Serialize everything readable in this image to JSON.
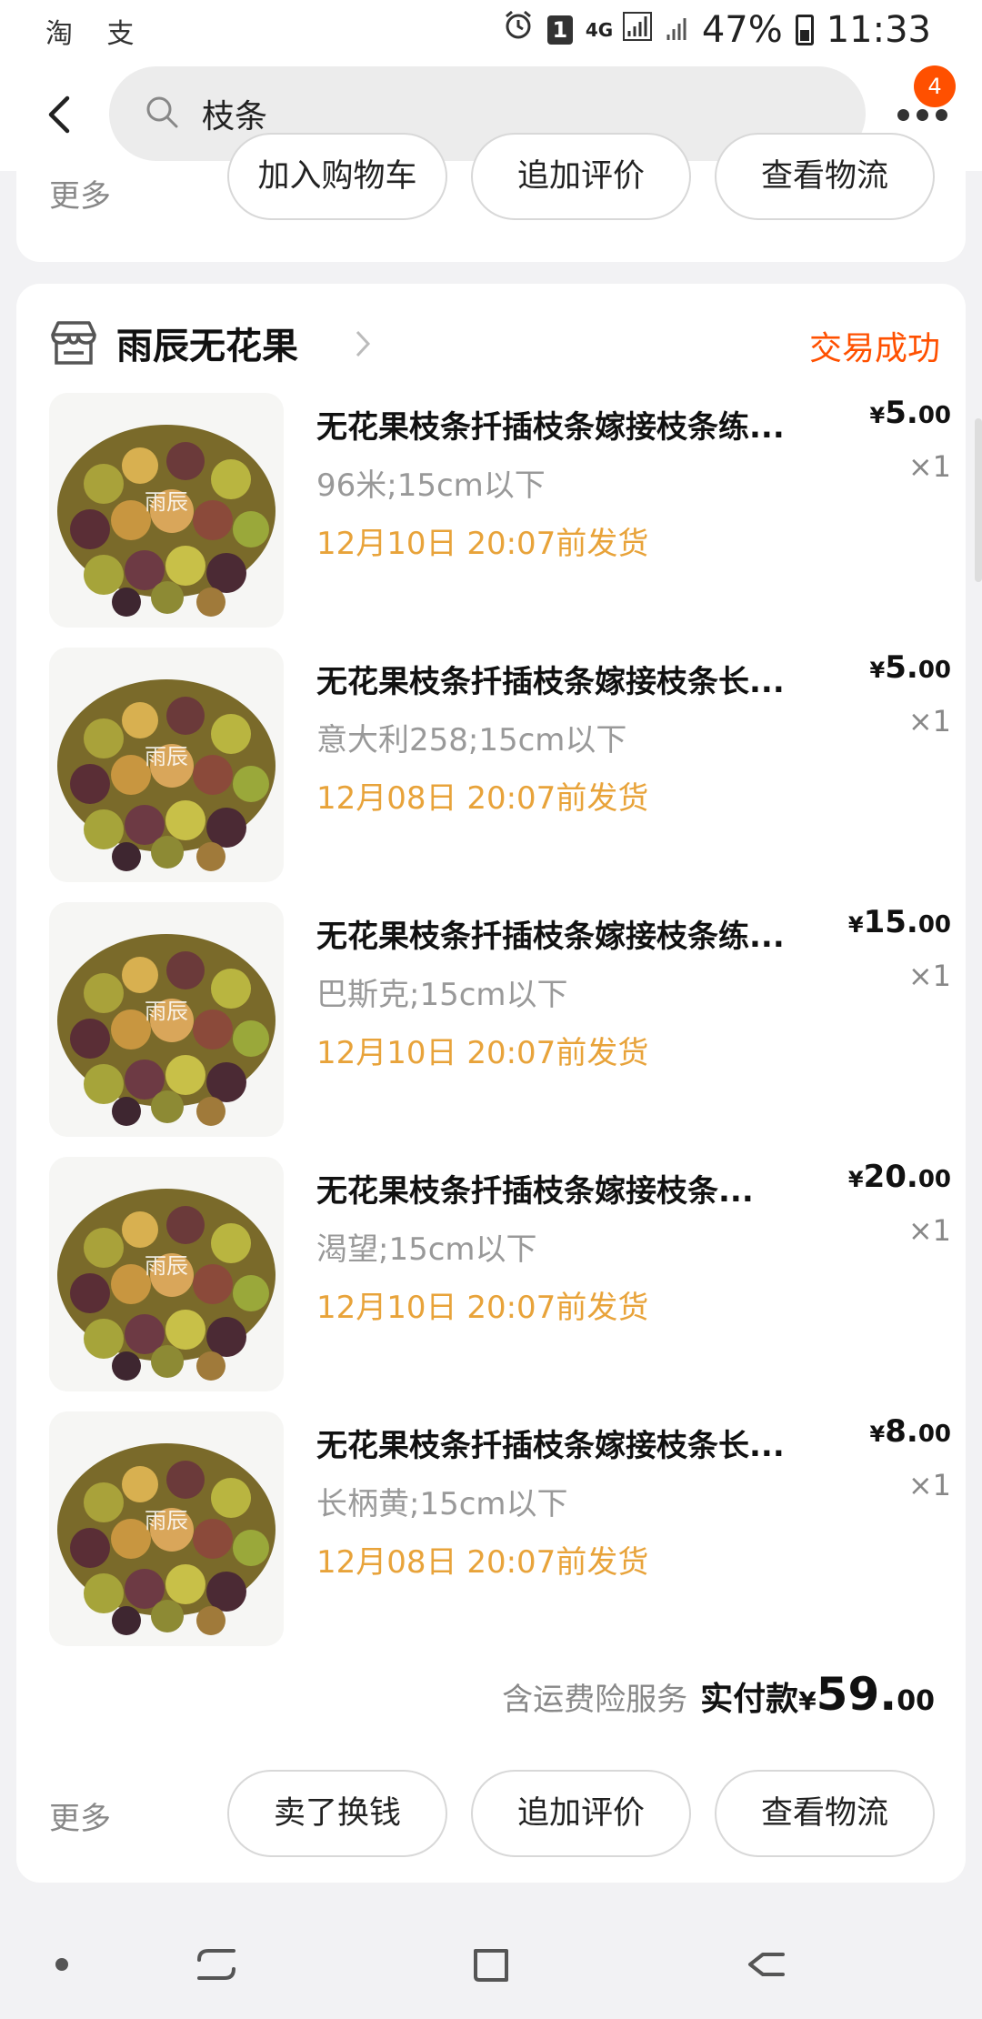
{
  "status_bar": {
    "left_icons": [
      "taobao-icon",
      "alipay-icon"
    ],
    "left_text": "淘 支",
    "badge": "1",
    "network": "4G",
    "battery": "47%",
    "time": "11:33"
  },
  "header": {
    "search_query": "枝条",
    "message_count": "4"
  },
  "top_card": {
    "more_label": "更多",
    "buttons": [
      "加入购物车",
      "追加评价",
      "查看物流"
    ]
  },
  "order": {
    "shop_name": "雨辰无花果",
    "status": "交易成功",
    "watermark": "雨辰",
    "items": [
      {
        "title": "无花果枝条扦插枝条嫁接枝条练...",
        "sku": "96米;15cm以下",
        "ship": "12月10日 20:07前发货",
        "price_symbol": "¥",
        "price_int": "5.",
        "price_dec": "00",
        "qty": "×1"
      },
      {
        "title": "无花果枝条扦插枝条嫁接枝条长...",
        "sku": "意大利258;15cm以下",
        "ship": "12月08日 20:07前发货",
        "price_symbol": "¥",
        "price_int": "5.",
        "price_dec": "00",
        "qty": "×1"
      },
      {
        "title": "无花果枝条扦插枝条嫁接枝条练...",
        "sku": "巴斯克;15cm以下",
        "ship": "12月10日 20:07前发货",
        "price_symbol": "¥",
        "price_int": "15.",
        "price_dec": "00",
        "qty": "×1"
      },
      {
        "title": "无花果枝条扦插枝条嫁接枝条...",
        "sku": "渴望;15cm以下",
        "ship": "12月10日 20:07前发货",
        "price_symbol": "¥",
        "price_int": "20.",
        "price_dec": "00",
        "qty": "×1"
      },
      {
        "title": "无花果枝条扦插枝条嫁接枝条长...",
        "sku": "长柄黄;15cm以下",
        "ship": "12月08日 20:07前发货",
        "price_symbol": "¥",
        "price_int": "8.",
        "price_dec": "00",
        "qty": "×1"
      }
    ],
    "total": {
      "note": "含运费险服务",
      "label": "实付款",
      "symbol": "¥",
      "int": "59.",
      "dec": "00"
    },
    "more_label": "更多",
    "buttons": [
      "卖了换钱",
      "追加评价",
      "查看物流"
    ]
  },
  "colors": {
    "accent": "#ff5000",
    "ship_text": "#e8a33a",
    "muted": "#999999"
  }
}
